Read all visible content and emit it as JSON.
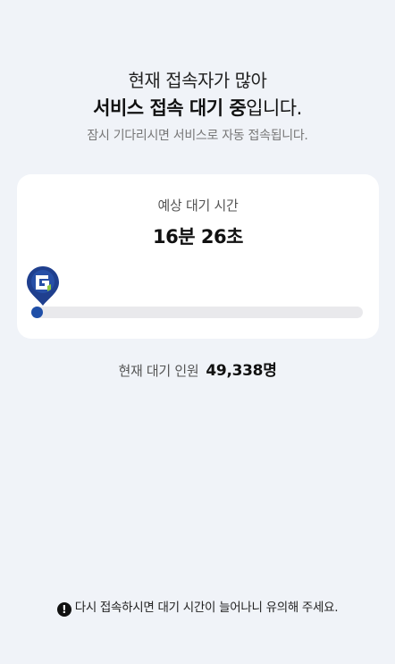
{
  "header": {
    "line1": "현재 접속자가 많아",
    "line2_bold": "서비스 접속 대기 중",
    "line2_rest": "입니다.",
    "subtitle": "잠시 기다리시면 서비스로 자동 접속됩니다."
  },
  "wait_card": {
    "estimated_label": "예상 대기 시간",
    "estimated_value": "16분 26초",
    "progress_fraction": 0.0,
    "marker_icon": "location-pin-icon",
    "accent_color": "#1f4fa8"
  },
  "queue": {
    "label": "현재 대기 인원",
    "count": "49,338명"
  },
  "notice": {
    "icon": "warning-icon",
    "glyph": "!",
    "text": "다시 접속하시면 대기 시간이 늘어나니 유의해 주세요."
  }
}
